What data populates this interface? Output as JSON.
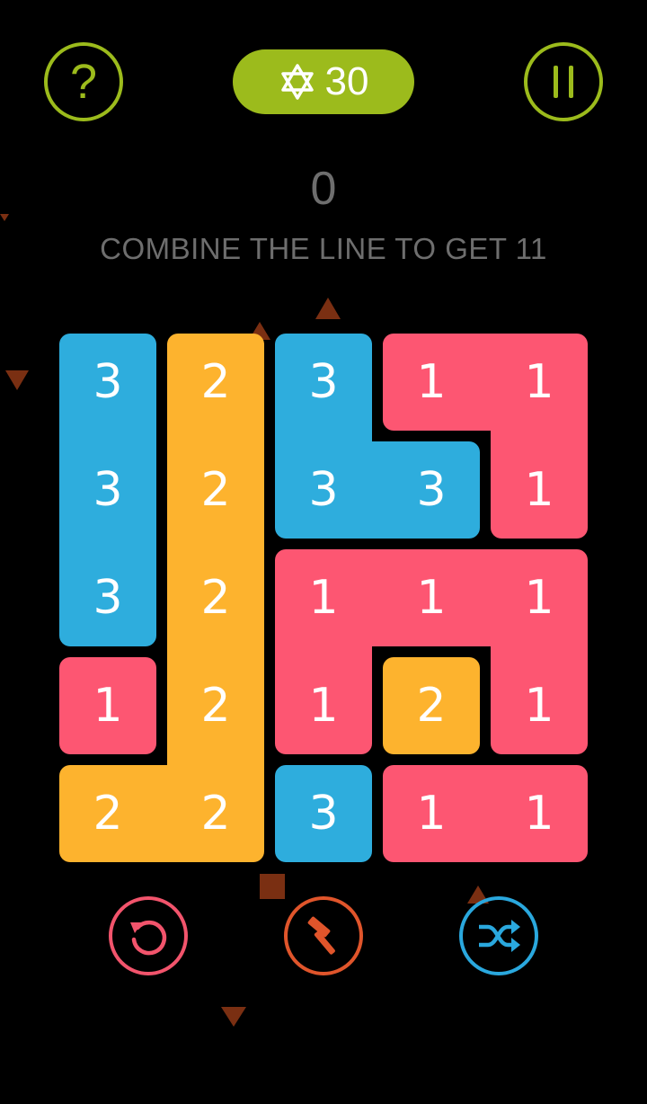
{
  "header": {
    "help_label": "?",
    "star_count": "30",
    "star_icon": "star-of-david-icon",
    "pause_icon": "pause-icon"
  },
  "score": "0",
  "instruction": "COMBINE THE LINE TO GET 11",
  "colors": {
    "accent": "#9cbb1c",
    "blue": "#2eaddd",
    "yellow": "#fdb32e",
    "pink": "#fd5672",
    "undo": "#f2546c",
    "hammer": "#e0552b",
    "shuffle": "#2aa8de",
    "debris": "#7a2f12"
  },
  "board": {
    "rows": 5,
    "cols": 5,
    "values": [
      [
        "3",
        "2",
        "3",
        "1",
        "1"
      ],
      [
        "3",
        "2",
        "3",
        "3",
        "1"
      ],
      [
        "3",
        "2",
        "1",
        "1",
        "1"
      ],
      [
        "1",
        "2",
        "1",
        "2",
        "1"
      ],
      [
        "2",
        "2",
        "3",
        "1",
        "1"
      ]
    ],
    "groups": [
      [
        0,
        1,
        2,
        3,
        3
      ],
      [
        0,
        1,
        2,
        2,
        3
      ],
      [
        0,
        1,
        4,
        4,
        4
      ],
      [
        5,
        1,
        4,
        6,
        4
      ],
      [
        1,
        1,
        7,
        8,
        8
      ]
    ],
    "group_colors": [
      "blue",
      "yellow",
      "blue",
      "pink",
      "pink",
      "pink",
      "yellow",
      "blue",
      "pink"
    ]
  },
  "tools": [
    {
      "name": "undo-button",
      "icon": "undo-icon",
      "color": "undo"
    },
    {
      "name": "hammer-button",
      "icon": "hammer-icon",
      "color": "hammer"
    },
    {
      "name": "shuffle-button",
      "icon": "shuffle-icon",
      "color": "shuffle"
    }
  ]
}
